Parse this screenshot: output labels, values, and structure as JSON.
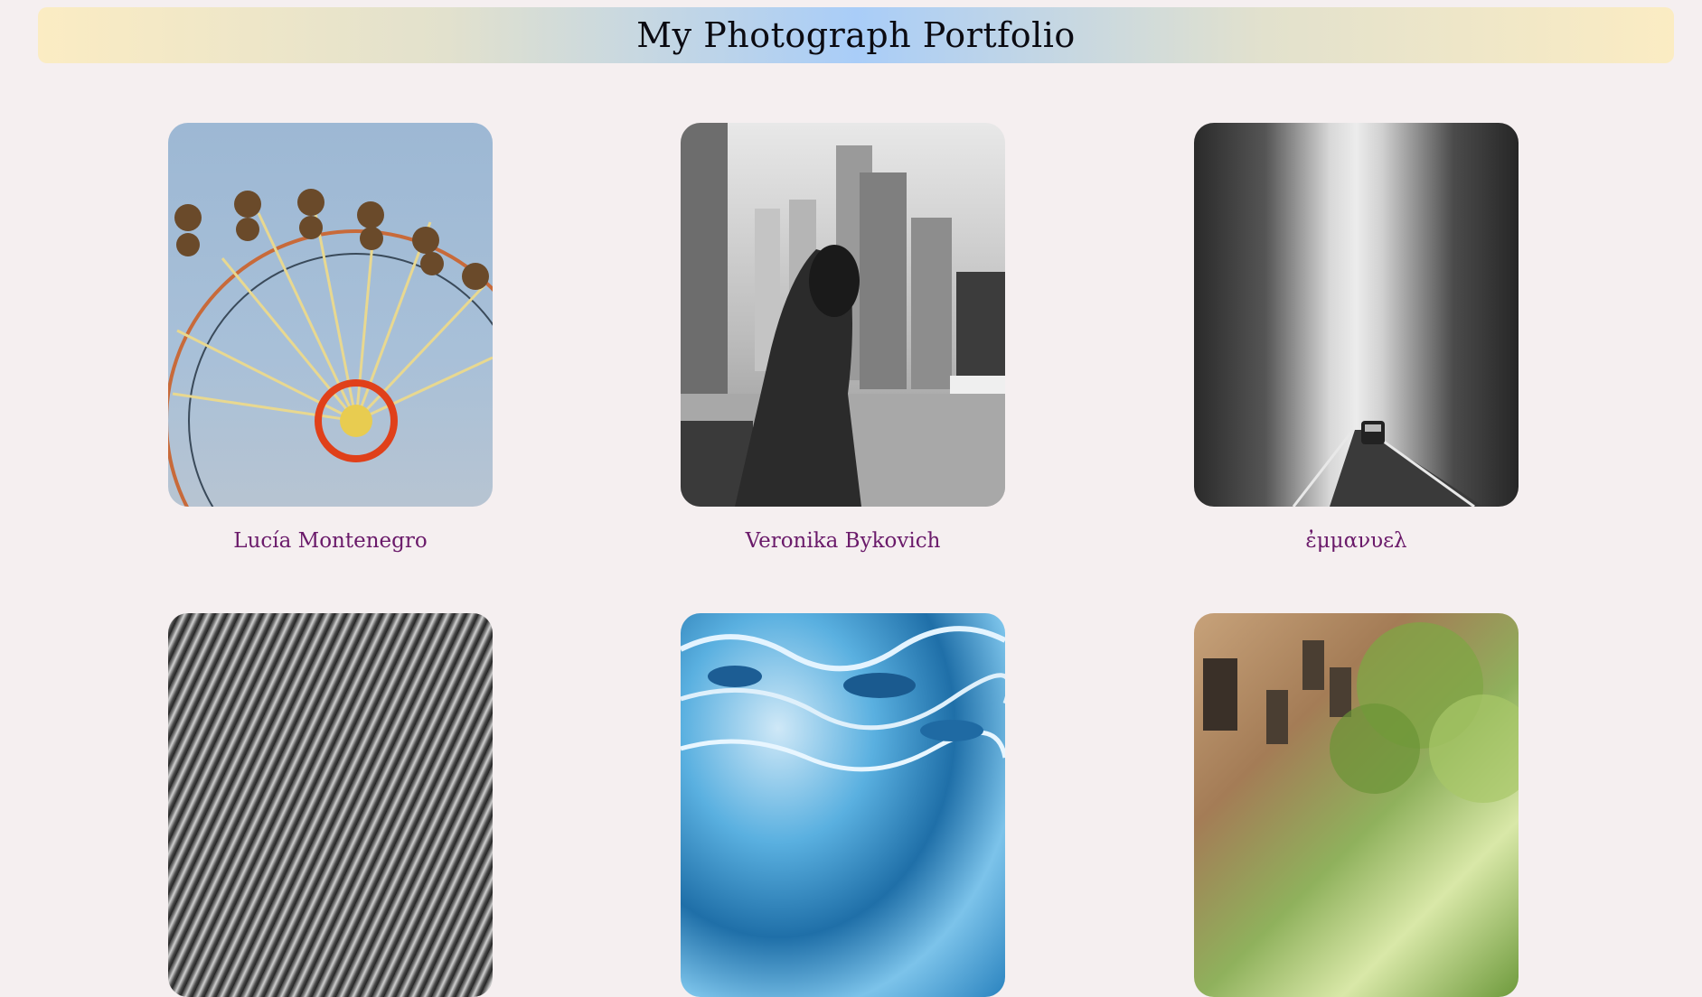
{
  "header": {
    "title": "My Photograph Portfolio"
  },
  "gallery": {
    "items": [
      {
        "photographer": "Lucía Montenegro",
        "image": "ferris-wheel-photo"
      },
      {
        "photographer": "Veronika Bykovich",
        "image": "city-woman-photo"
      },
      {
        "photographer": "ἐμμανυελ",
        "image": "foggy-road-photo"
      },
      {
        "photographer": "",
        "image": "grass-photo"
      },
      {
        "photographer": "",
        "image": "blue-ice-photo"
      },
      {
        "photographer": "",
        "image": "building-tree-photo"
      }
    ]
  }
}
